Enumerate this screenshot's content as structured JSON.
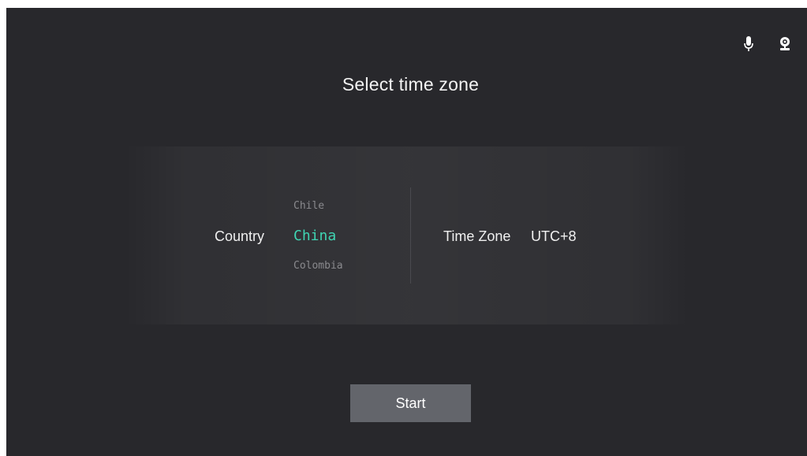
{
  "status_bar": {
    "icons": [
      "microphone-icon",
      "webcam-icon"
    ]
  },
  "title": "Select time zone",
  "country": {
    "label": "Country",
    "options_visible": [
      "Chile",
      "China",
      "Colombia"
    ],
    "previous": "Chile",
    "selected": "China",
    "next": "Colombia"
  },
  "time_zone": {
    "label": "Time Zone",
    "value": "UTC+8"
  },
  "start_button": {
    "label": "Start"
  },
  "colors": {
    "background": "#28282c",
    "accent_selected": "#3fd5b3",
    "button": "#63656b",
    "muted_text": "#8a8a8e"
  }
}
